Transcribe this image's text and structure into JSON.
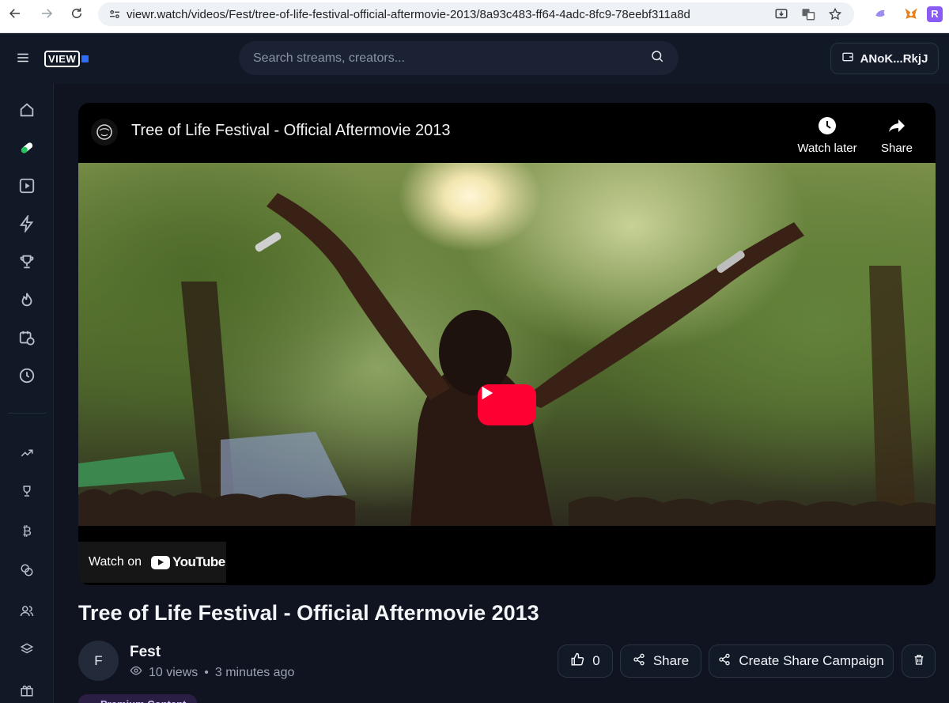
{
  "browser": {
    "url": "viewr.watch/videos/Fest/tree-of-life-festival-official-aftermovie-2013/8a93c483-ff64-4adc-8fc9-78eebf311a8d",
    "icons": [
      "back-icon",
      "forward-icon",
      "reload-icon",
      "site-settings-icon",
      "install-icon",
      "translate-icon",
      "bookmark-star-icon",
      "extension-icon",
      "metamask-fox-icon",
      "extension-r-icon"
    ]
  },
  "header": {
    "logo_text": "VIEW",
    "search_placeholder": "Search streams, creators...",
    "wallet_label": "ANoK...RkjJ"
  },
  "sidebar": {
    "items": [
      "home",
      "pill",
      "play",
      "lightning",
      "trophy",
      "fire",
      "calendar-clock",
      "clock",
      "trending",
      "trophy-small",
      "bitcoin",
      "coins",
      "users",
      "layers",
      "gift"
    ]
  },
  "player": {
    "title": "Tree of Life Festival - Official Aftermovie 2013",
    "watch_later_label": "Watch later",
    "share_label": "Share",
    "watch_on_label": "Watch on",
    "youtube_label": "YouTube"
  },
  "video": {
    "title": "Tree of Life Festival - Official Aftermovie 2013",
    "creator_initial": "F",
    "creator_name": "Fest",
    "views": "10 views",
    "separator": "•",
    "posted": "3 minutes ago",
    "like_count": "0",
    "share_label": "Share",
    "campaign_label": "Create Share Campaign",
    "premium_label": "Premium Content"
  },
  "colors": {
    "background": "#0f1420",
    "youtube_red": "#ff0033",
    "accent_green": "#22c55e"
  }
}
